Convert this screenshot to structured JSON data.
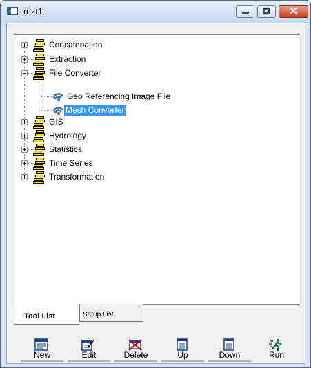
{
  "window": {
    "title": "mzt1",
    "minimize_glyph": "minimize-icon",
    "maximize_glyph": "maximize-icon",
    "close_glyph": "✕"
  },
  "tree": {
    "items": [
      {
        "label": "Concatenation",
        "icon": "folder-stack-icon",
        "expander": "plus"
      },
      {
        "label": "Extraction",
        "icon": "folder-stack-icon",
        "expander": "plus"
      },
      {
        "label": "File Converter",
        "icon": "folder-stack-icon",
        "expander": "minus",
        "children": [
          {
            "label": "Geo Referencing Image File",
            "icon": "tool-icon"
          },
          {
            "label": "Mesh Converter",
            "icon": "tool-icon",
            "selected": true
          }
        ]
      },
      {
        "label": "GIS",
        "icon": "folder-stack-icon",
        "expander": "plus"
      },
      {
        "label": "Hydrology",
        "icon": "folder-stack-icon",
        "expander": "plus"
      },
      {
        "label": "Statistics",
        "icon": "folder-stack-icon",
        "expander": "plus"
      },
      {
        "label": "Time Series",
        "icon": "folder-stack-icon",
        "expander": "plus"
      },
      {
        "label": "Transformation",
        "icon": "folder-stack-icon",
        "expander": "plus"
      }
    ]
  },
  "tabs": {
    "tool_list": "Tool List",
    "setup_list": "Setup List"
  },
  "toolbar": {
    "new": "New",
    "edit": "Edit",
    "delete": "Delete",
    "up": "Up",
    "down": "Down",
    "run": "Run"
  },
  "colors": {
    "selection": "#3399ff",
    "folder_yellow": "#ffd800",
    "close_red": "#c4401f"
  }
}
